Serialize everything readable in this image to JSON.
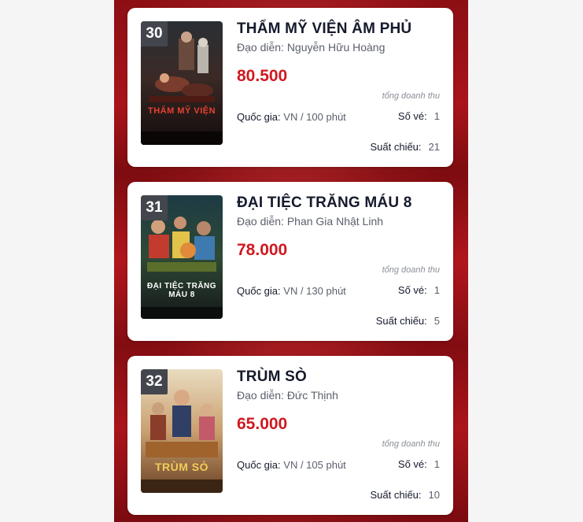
{
  "list": {
    "revenue_label": "tổng doanh thu",
    "country_label": "Quốc gia:",
    "tickets_label": "Số vé:",
    "shows_label": "Suất chiếu:",
    "movies": [
      {
        "rank": "30",
        "title": "THẨM MỸ VIỆN ÂM PHỦ",
        "director": "Đạo diễn: Nguyễn Hữu Hoàng",
        "revenue": "80.500",
        "country_value": "VN / 100 phút",
        "tickets": "1",
        "shows": "21",
        "poster_text": "THẨM MỸ VIỆN"
      },
      {
        "rank": "31",
        "title": "ĐẠI TIỆC TRĂNG MÁU 8",
        "director": "Đạo diễn: Phan Gia Nhật Linh",
        "revenue": "78.000",
        "country_value": "VN / 130 phút",
        "tickets": "1",
        "shows": "5",
        "poster_text": "ĐẠI TIỆC TRĂNG MÁU 8"
      },
      {
        "rank": "32",
        "title": "TRÙM SÒ",
        "director": "Đạo diễn: Đức Thịnh",
        "revenue": "65.000",
        "country_value": "VN / 105 phút",
        "tickets": "1",
        "shows": "10",
        "poster_text": "TRÙM SÒ"
      }
    ]
  }
}
